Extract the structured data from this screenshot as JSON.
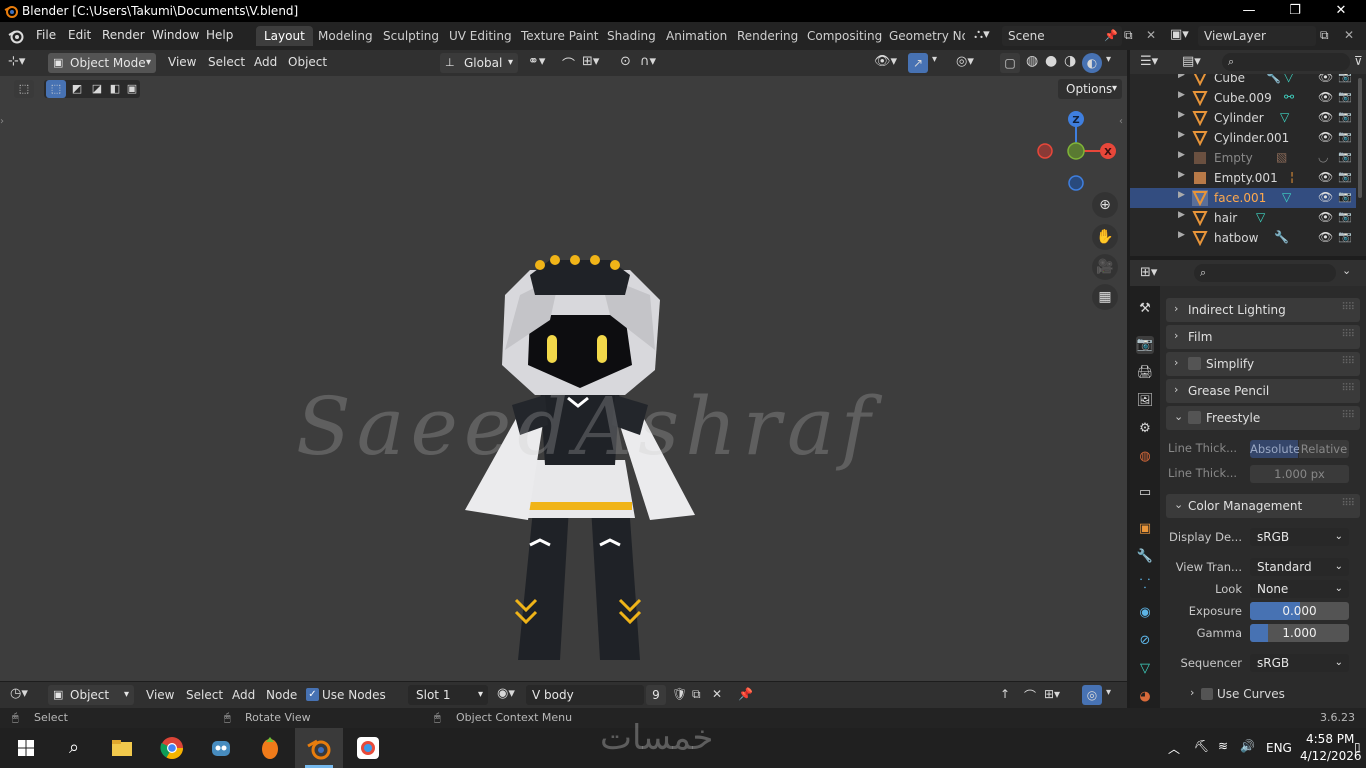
{
  "window": {
    "title": "Blender [C:\\Users\\Takumi\\Documents\\V.blend]",
    "minimize": "—",
    "maximize": "❐",
    "close": "✕"
  },
  "menubar": {
    "items": [
      "File",
      "Edit",
      "Render",
      "Window",
      "Help"
    ],
    "workspaces": [
      "Layout",
      "Modeling",
      "Sculpting",
      "UV Editing",
      "Texture Paint",
      "Shading",
      "Animation",
      "Rendering",
      "Compositing",
      "Geometry Noc"
    ],
    "active_workspace": "Layout",
    "scene": "Scene",
    "view_layer": "ViewLayer"
  },
  "viewport_header": {
    "mode": "Object Mode",
    "menus": [
      "View",
      "Select",
      "Add",
      "Object"
    ],
    "transform_orientation": "Global",
    "options_label": "Options"
  },
  "gizmo": {
    "z": "Z",
    "x": "X"
  },
  "watermark_text": "SaeedAshraf",
  "node_header": {
    "editor": "Object",
    "menus": [
      "View",
      "Select",
      "Add",
      "Node"
    ],
    "use_nodes_label": "Use Nodes",
    "slot": "Slot 1",
    "material": "V body",
    "users": "9"
  },
  "outliner": {
    "rows": [
      {
        "name": "Cube",
        "selected": false
      },
      {
        "name": "Cube.009",
        "selected": false
      },
      {
        "name": "Cylinder",
        "selected": false
      },
      {
        "name": "Cylinder.001",
        "selected": false
      },
      {
        "name": "Empty",
        "selected": false
      },
      {
        "name": "Empty.001",
        "selected": false
      },
      {
        "name": "face.001",
        "selected": true
      },
      {
        "name": "hair",
        "selected": false
      },
      {
        "name": "hatbow",
        "selected": false
      }
    ]
  },
  "properties": {
    "panels": {
      "indirect_lighting": "Indirect Lighting",
      "film": "Film",
      "simplify": "Simplify",
      "grease_pencil": "Grease Pencil",
      "freestyle": "Freestyle",
      "color_management": "Color Management"
    },
    "freestyle": {
      "line_thickness_mode_label": "Line Thick...",
      "mode_absolute": "Absolute",
      "mode_relative": "Relative",
      "line_thickness_label": "Line Thick...",
      "line_thickness_value": "1.000 px"
    },
    "color_management": {
      "display_device_label": "Display De...",
      "display_device": "sRGB",
      "view_transform_label": "View Tran...",
      "view_transform": "Standard",
      "look_label": "Look",
      "look": "None",
      "exposure_label": "Exposure",
      "exposure": "0.000",
      "exposure_fill": 0.5,
      "gamma_label": "Gamma",
      "gamma": "1.000",
      "gamma_fill": 0.18,
      "sequencer_label": "Sequencer",
      "sequencer": "sRGB",
      "use_curves_label": "Use Curves"
    }
  },
  "statusbar": {
    "select": "Select",
    "rotate": "Rotate View",
    "context_menu": "Object Context Menu",
    "version": "3.6.23",
    "brand": "خمسات"
  },
  "taskbar": {
    "language": "ENG",
    "time": "4:58 PM",
    "date": "4/12/2026"
  },
  "colors": {
    "accent": "#4772b3",
    "selection": "#334d80",
    "viewport_bg": "#3d3d3d",
    "header_bg": "#303030",
    "axis_x": "#e8473a",
    "axis_y": "#7fb537",
    "axis_z": "#3f7fdf",
    "object_orange": "#e8953a"
  }
}
